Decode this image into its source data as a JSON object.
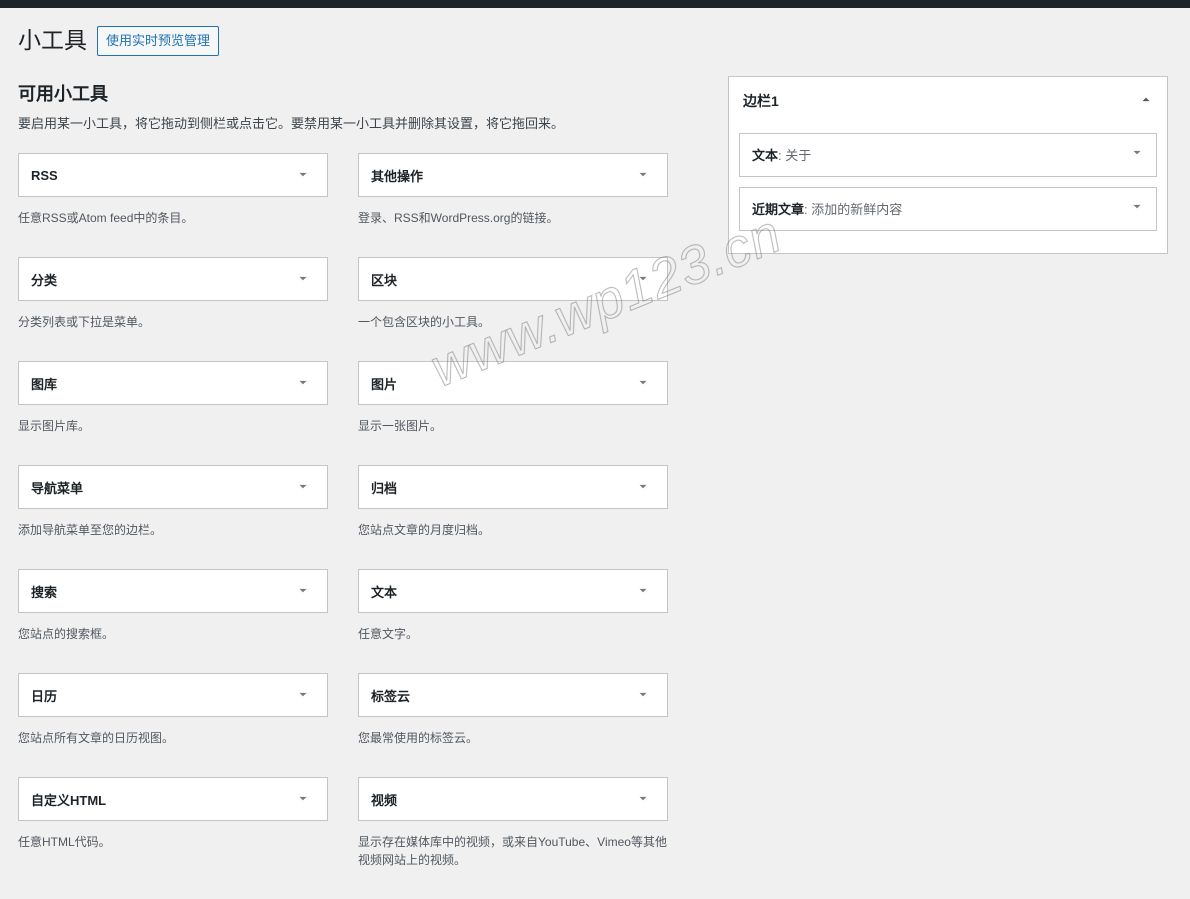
{
  "header": {
    "page_title": "小工具",
    "preview_button": "使用实时预览管理"
  },
  "available": {
    "heading": "可用小工具",
    "description": "要启用某一小工具，将它拖动到侧栏或点击它。要禁用某一小工具并删除其设置，将它拖回来。"
  },
  "widgets_left": [
    {
      "title": "RSS",
      "desc": "任意RSS或Atom feed中的条目。"
    },
    {
      "title": "分类",
      "desc": "分类列表或下拉是菜单。"
    },
    {
      "title": "图库",
      "desc": "显示图片库。"
    },
    {
      "title": "导航菜单",
      "desc": "添加导航菜单至您的边栏。"
    },
    {
      "title": "搜索",
      "desc": "您站点的搜索框。"
    },
    {
      "title": "日历",
      "desc": "您站点所有文章的日历视图。"
    },
    {
      "title": "自定义HTML",
      "desc": "任意HTML代码。"
    }
  ],
  "widgets_right": [
    {
      "title": "其他操作",
      "desc": "登录、RSS和WordPress.org的链接。"
    },
    {
      "title": "区块",
      "desc": "一个包含区块的小工具。"
    },
    {
      "title": "图片",
      "desc": "显示一张图片。"
    },
    {
      "title": "归档",
      "desc": "您站点文章的月度归档。"
    },
    {
      "title": "文本",
      "desc": "任意文字。"
    },
    {
      "title": "标签云",
      "desc": "您最常使用的标签云。"
    },
    {
      "title": "视频",
      "desc": "显示存在媒体库中的视频，或来自YouTube、Vimeo等其他视频网站上的视频。"
    }
  ],
  "sidebar": {
    "title": "边栏1",
    "items": [
      {
        "name": "文本",
        "sub": ": 关于"
      },
      {
        "name": "近期文章",
        "sub": ": 添加的新鲜内容"
      }
    ]
  },
  "watermark": "www.wp123.cn"
}
